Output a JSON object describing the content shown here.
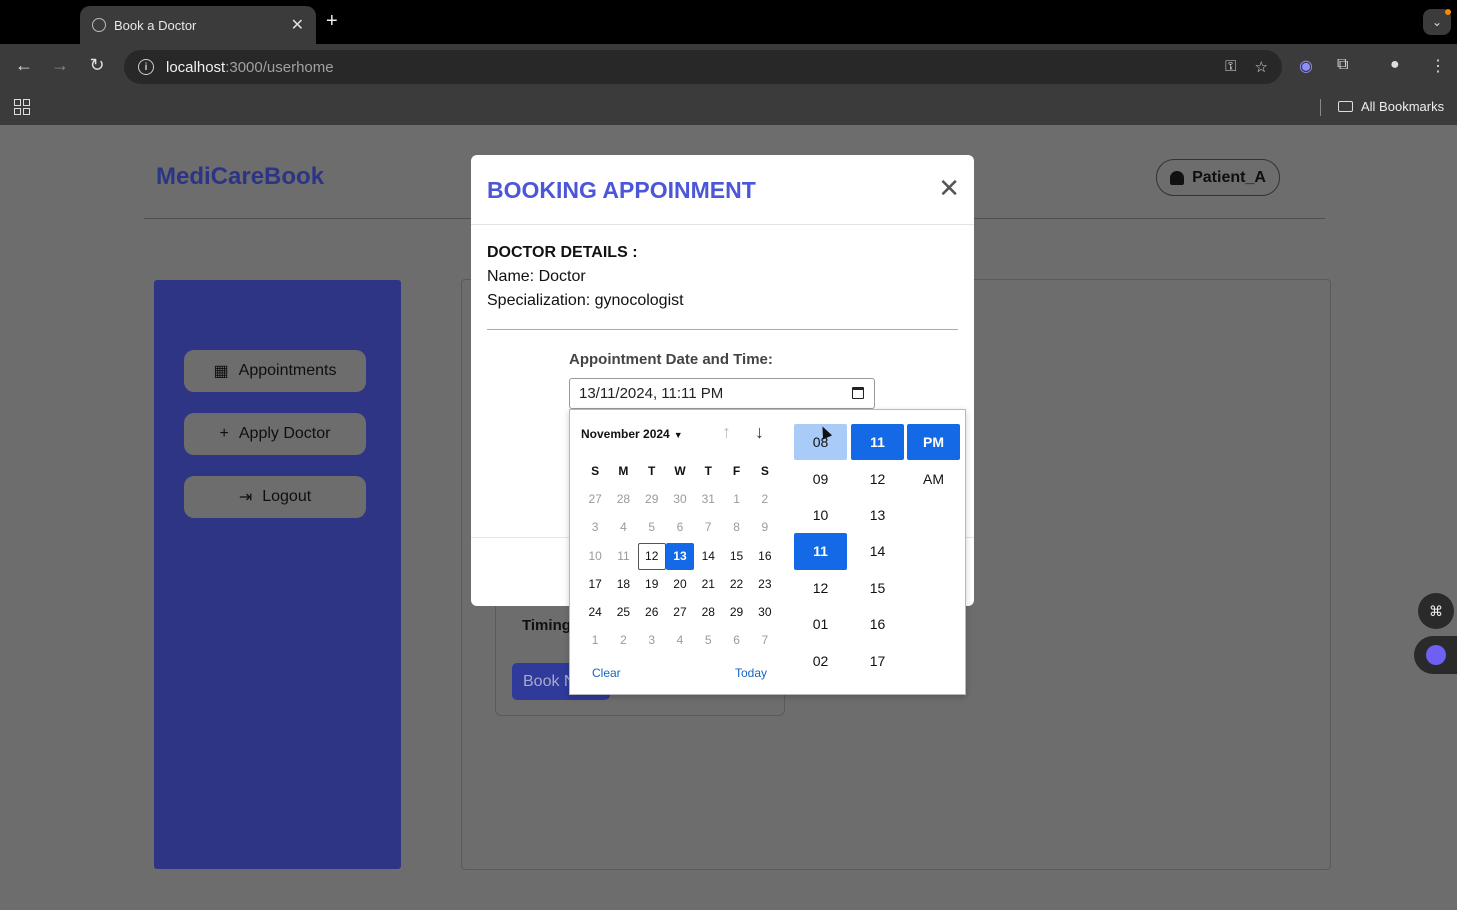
{
  "browser": {
    "tab_title": "Book a Doctor",
    "tab_close": "✕",
    "new_tab": "+",
    "url_host": "localhost",
    "url_path": ":3000/userhome",
    "bookmarks_label": "All Bookmarks",
    "icons": [
      "back-icon",
      "forward-icon",
      "reload-icon",
      "info-icon",
      "key-icon",
      "star-icon",
      "extensions-icon",
      "profile-icon",
      "menu-icon"
    ]
  },
  "app": {
    "brand": "MediCareBook",
    "user_button": "Patient_A",
    "sidebar": [
      {
        "label": "Appointments",
        "icon": "calendar-icon"
      },
      {
        "label": "Apply Doctor",
        "icon": "plus-icon"
      },
      {
        "label": "Logout",
        "icon": "logout-icon"
      }
    ],
    "card_timing": "Timing",
    "card_button": "Book N"
  },
  "modal": {
    "title": "BOOKING APPOINMENT",
    "close": "✕",
    "details_heading": "DOCTOR DETAILS :",
    "name_line": "Name:  Doctor",
    "spec_line": "Specialization: gynocologist",
    "datetime_label": "Appointment Date and Time:",
    "datetime_value": "13/11/2024, 11:11 PM"
  },
  "picker": {
    "month_label": "November 2024",
    "weekdays": [
      "S",
      "M",
      "T",
      "W",
      "T",
      "F",
      "S"
    ],
    "weeks": [
      [
        "27",
        "28",
        "29",
        "30",
        "31",
        "1",
        "2"
      ],
      [
        "3",
        "4",
        "5",
        "6",
        "7",
        "8",
        "9"
      ],
      [
        "10",
        "11",
        "12",
        "13",
        "14",
        "15",
        "16"
      ],
      [
        "17",
        "18",
        "19",
        "20",
        "21",
        "22",
        "23"
      ],
      [
        "24",
        "25",
        "26",
        "27",
        "28",
        "29",
        "30"
      ],
      [
        "1",
        "2",
        "3",
        "4",
        "5",
        "6",
        "7"
      ]
    ],
    "clear": "Clear",
    "today": "Today",
    "hours": [
      "08",
      "09",
      "10",
      "11",
      "12",
      "01",
      "02"
    ],
    "minutes": [
      "11",
      "12",
      "13",
      "14",
      "15",
      "16",
      "17"
    ],
    "meridiem": [
      "PM",
      "AM"
    ],
    "selected_color": "#1469e6"
  }
}
